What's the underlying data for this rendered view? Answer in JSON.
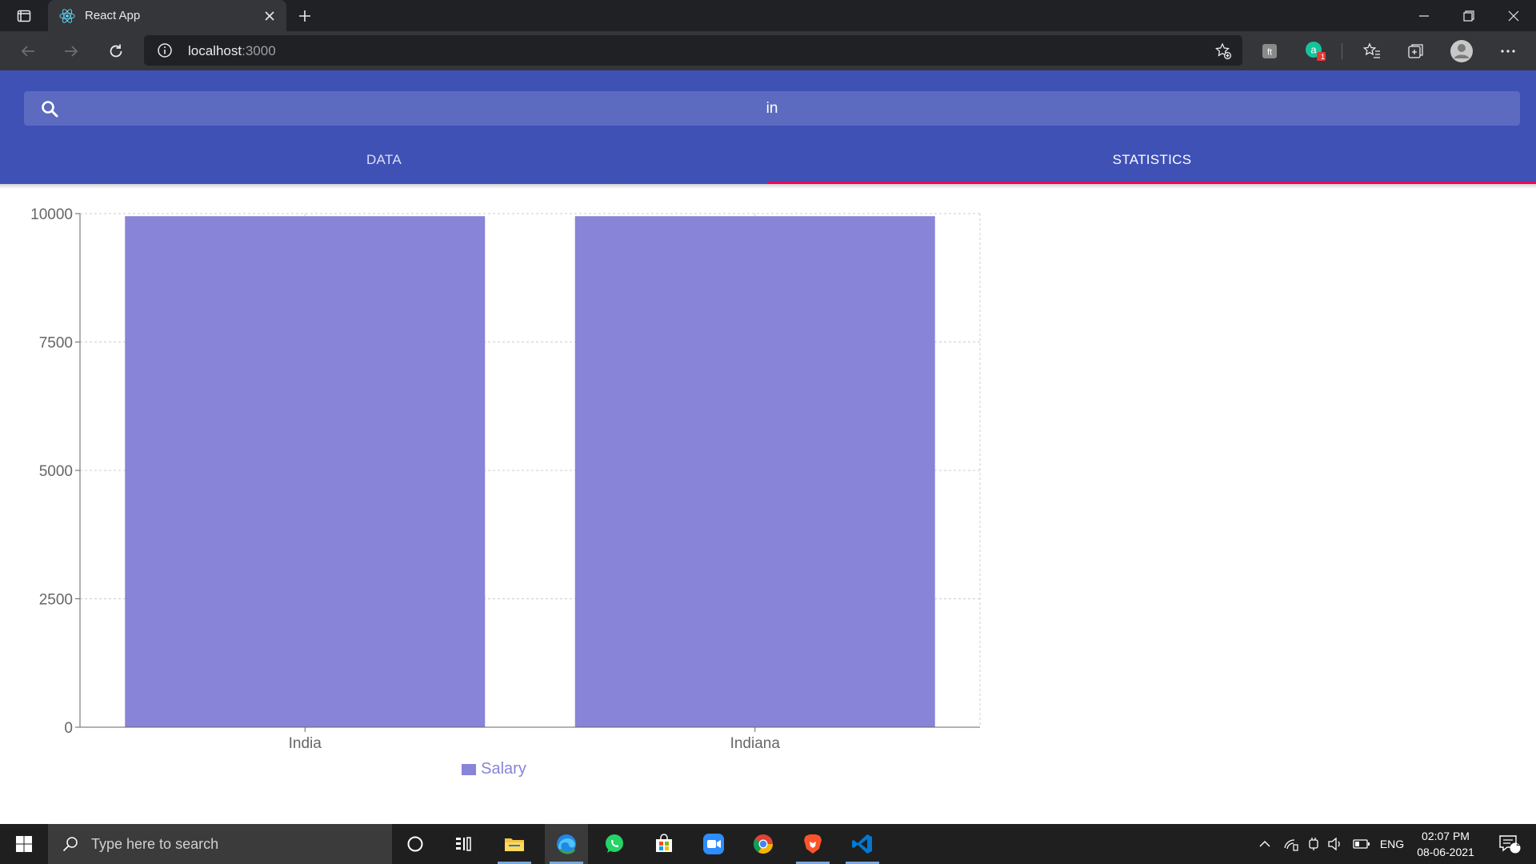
{
  "browser": {
    "tab_title": "React App",
    "url_host": "localhost",
    "url_port": ":3000",
    "extension_badge": "1"
  },
  "app": {
    "search_value": "in",
    "tabs": [
      {
        "label": "DATA",
        "active": false
      },
      {
        "label": "STATISTICS",
        "active": true
      }
    ],
    "header_color": "#3f51b5",
    "search_color": "#5c6bc0",
    "indicator_color": "#f50057"
  },
  "chart_data": {
    "type": "bar",
    "categories": [
      "India",
      "Indiana"
    ],
    "series": [
      {
        "name": "Salary",
        "values": [
          9950,
          9950
        ],
        "color": "#8884d8"
      }
    ],
    "yticks": [
      "0",
      "2500",
      "5000",
      "7500",
      "10000"
    ],
    "ylim": [
      0,
      10000
    ],
    "grid": true,
    "legend": "bottom"
  },
  "taskbar": {
    "search_placeholder": "Type here to search",
    "language": "ENG",
    "time": "02:07 PM",
    "date": "08-06-2021",
    "notification_count": "2",
    "apps": [
      "cortana",
      "task-view",
      "file-explorer",
      "edge",
      "whatsapp",
      "store",
      "zoom",
      "chrome",
      "brave",
      "vscode"
    ]
  }
}
